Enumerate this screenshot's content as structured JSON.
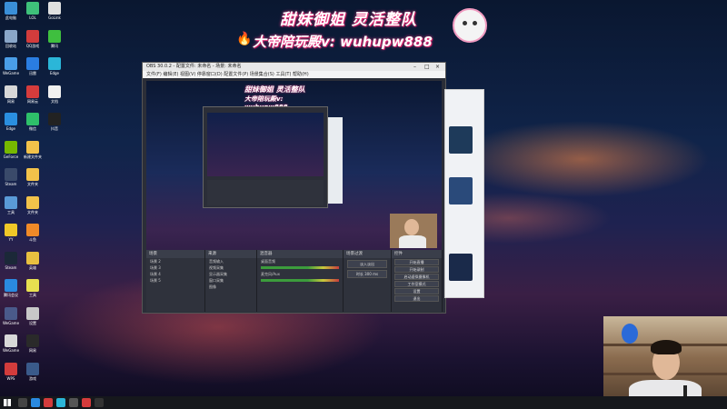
{
  "banner": {
    "line1": "甜妹御姐 灵活整队",
    "line2": "大帝陪玩殿v: wuhupw888"
  },
  "colors": {
    "accent": "#ff3c8c",
    "taskbar": "#16181c",
    "obs_bg": "#2b2e38"
  },
  "desktop_icons": [
    {
      "label": "此电脑",
      "icon": "computer-icon",
      "color": "#3a8fd8",
      "col": 0,
      "row": 0
    },
    {
      "label": "LOL",
      "icon": "game-icon",
      "color": "#3ec07a",
      "col": 1,
      "row": 0
    },
    {
      "label": "GoLink",
      "icon": "app-icon",
      "color": "#e0e0e0",
      "col": 2,
      "row": 0
    },
    {
      "label": "回收站",
      "icon": "recycle-bin-icon",
      "color": "#8aa6c8",
      "col": 0,
      "row": 1
    },
    {
      "label": "QQ游戏",
      "icon": "app-icon",
      "color": "#d23c3c",
      "col": 1,
      "row": 1
    },
    {
      "label": "腾讯",
      "icon": "app-icon",
      "color": "#3fbf3f",
      "col": 2,
      "row": 1
    },
    {
      "label": "WeGame",
      "icon": "app-icon",
      "color": "#4a9ee8",
      "col": 0,
      "row": 2
    },
    {
      "label": "迅雷",
      "icon": "app-icon",
      "color": "#2a7de1",
      "col": 1,
      "row": 2
    },
    {
      "label": "Edge",
      "icon": "edge-icon",
      "color": "#2bb6d8",
      "col": 2,
      "row": 2
    },
    {
      "label": "网易",
      "icon": "app-icon",
      "color": "#d8d8d8",
      "col": 0,
      "row": 3
    },
    {
      "label": "网易云",
      "icon": "music-icon",
      "color": "#d63c3c",
      "col": 1,
      "row": 3
    },
    {
      "label": "文档",
      "icon": "document-icon",
      "color": "#f0f0f0",
      "col": 2,
      "row": 3
    },
    {
      "label": "Edge",
      "icon": "edge-icon",
      "color": "#2a8fe0",
      "col": 0,
      "row": 4
    },
    {
      "label": "微信",
      "icon": "wechat-icon",
      "color": "#2ec06a",
      "col": 1,
      "row": 4
    },
    {
      "label": "抖音",
      "icon": "app-icon",
      "color": "#222222",
      "col": 2,
      "row": 4
    },
    {
      "label": "GeForce",
      "icon": "app-icon",
      "color": "#76b900",
      "col": 0,
      "row": 5
    },
    {
      "label": "新建文件夹",
      "icon": "folder-icon",
      "color": "#f2c24a",
      "col": 1,
      "row": 5
    },
    {
      "label": "Steam",
      "icon": "app-icon",
      "color": "#3a4a6a",
      "col": 0,
      "row": 6
    },
    {
      "label": "文件夹",
      "icon": "folder-icon",
      "color": "#f2c24a",
      "col": 1,
      "row": 6
    },
    {
      "label": "工具",
      "icon": "app-icon",
      "color": "#5a9ad8",
      "col": 0,
      "row": 7
    },
    {
      "label": "文件夹",
      "icon": "folder-icon",
      "color": "#f2c24a",
      "col": 1,
      "row": 7
    },
    {
      "label": "YY",
      "icon": "app-icon",
      "color": "#f0c828",
      "col": 0,
      "row": 8
    },
    {
      "label": "斗鱼",
      "icon": "app-icon",
      "color": "#f08a28",
      "col": 1,
      "row": 8
    },
    {
      "label": "Steam",
      "icon": "app-icon",
      "color": "#1b2838",
      "col": 0,
      "row": 9
    },
    {
      "label": "英雄",
      "icon": "app-icon",
      "color": "#e8c040",
      "col": 1,
      "row": 9
    },
    {
      "label": "腾讯会议",
      "icon": "app-icon",
      "color": "#2a8ae0",
      "col": 0,
      "row": 10
    },
    {
      "label": "工具",
      "icon": "app-icon",
      "color": "#e8e050",
      "col": 1,
      "row": 10
    },
    {
      "label": "WeGame",
      "icon": "app-icon",
      "color": "#4a5a8a",
      "col": 0,
      "row": 11
    },
    {
      "label": "设置",
      "icon": "gear-icon",
      "color": "#c8c8c8",
      "col": 1,
      "row": 11
    },
    {
      "label": "WeGame",
      "icon": "app-icon",
      "color": "#d8d8d8",
      "col": 0,
      "row": 12
    },
    {
      "label": "网易",
      "icon": "app-icon",
      "color": "#2a2a2a",
      "col": 1,
      "row": 12
    },
    {
      "label": "WPS",
      "icon": "app-icon",
      "color": "#d23c3c",
      "col": 0,
      "row": 13
    },
    {
      "label": "游戏",
      "icon": "app-icon",
      "color": "#3a5a8a",
      "col": 1,
      "row": 13
    }
  ],
  "obs": {
    "title": "OBS 30.0.2 - 配置文件: 未命名 - 场景: 未命名",
    "menu": "文件(F) 编辑(E) 视图(V) 停靠窗口(D) 配置文件(P) 场景集合(S) 工具(T) 帮助(H)",
    "docks": {
      "scenes": {
        "title": "场景",
        "items": [
          "场景 2",
          "场景 3",
          "场景 4",
          "场景 5"
        ]
      },
      "sources": {
        "title": "来源",
        "items": [
          "音频输入",
          "视频采集",
          "显示器采集",
          "窗口采集",
          "图像"
        ]
      },
      "mixer": {
        "title": "混音器",
        "items": [
          "桌面音频",
          "麦克风/Aux"
        ]
      },
      "transitions": {
        "title": "场景过渡",
        "items": [
          "淡入淡出",
          "时长 300 ms"
        ]
      },
      "controls": {
        "title": "控件",
        "items": [
          "开始直播",
          "开始录制",
          "启动虚拟摄像机",
          "工作室模式",
          "设置",
          "退出"
        ]
      }
    }
  }
}
